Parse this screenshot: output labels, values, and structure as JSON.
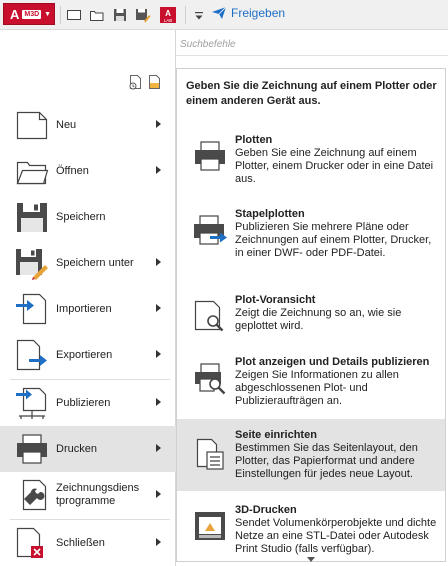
{
  "qat": {
    "app_button": {
      "label": "A",
      "badge": "M3D"
    },
    "share_label": "Freigeben",
    "icons": [
      "new-icon",
      "open-icon",
      "save-icon",
      "save-as-icon",
      "autodesk-app-icon",
      "quickaccess-dropdown-icon"
    ],
    "autodesk_badge": "A",
    "autodesk_sub": "LAB"
  },
  "search": {
    "placeholder": "Suchbefehle"
  },
  "menu": {
    "items": [
      {
        "label": "Neu"
      },
      {
        "label": "Öffnen"
      },
      {
        "label": "Speichern"
      },
      {
        "label": "Speichern unter"
      },
      {
        "label": "Importieren"
      },
      {
        "label": "Exportieren"
      },
      {
        "label": "Publizieren"
      },
      {
        "label": "Drucken"
      },
      {
        "label": "Zeichnungsdiens\ntprogramme"
      },
      {
        "label": "Schließen"
      }
    ]
  },
  "submenu": {
    "header": "Geben Sie die Zeichnung auf einem Plotter oder einem anderen Gerät aus.",
    "items": [
      {
        "title": "Plotten",
        "desc": "Geben Sie eine Zeichnung auf einem Plotter, einem Drucker oder in eine Datei aus."
      },
      {
        "title": "Stapelplotten",
        "desc": "Publizieren Sie mehrere Pläne oder Zeichnungen auf einem Plotter, Drucker, in einer DWF- oder PDF-Datei."
      },
      {
        "title": "Plot-Voransicht",
        "desc": "Zeigt die Zeichnung so an, wie sie geplottet wird."
      },
      {
        "title": "Plot anzeigen und Details publizieren",
        "desc": "Zeigen Sie Informationen zu allen abgeschlossenen Plot- und Publizieraufträgen an."
      },
      {
        "title": "Seite einrichten",
        "desc": "Bestimmen Sie das Seitenlayout, den Plotter, das Papierformat und andere Einstellungen für jedes neue Layout."
      },
      {
        "title": "3D-Drucken",
        "desc": "Sendet Volumenkörperobjekte und dichte Netze an eine STL-Datei oder Autodesk Print Studio (falls verfügbar)."
      }
    ]
  },
  "colors": {
    "accent": "#1f6fc5",
    "brand": "#c8102e",
    "active_bg": "#e3e3e3"
  }
}
